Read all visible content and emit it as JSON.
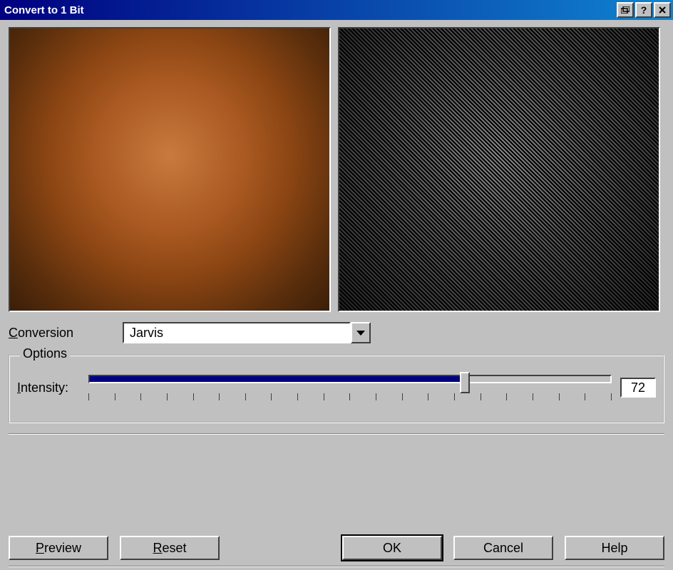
{
  "window": {
    "title": "Convert to 1 Bit"
  },
  "conversion": {
    "label_pre": "C",
    "label_rest": "onversion",
    "value": "Jarvis"
  },
  "options": {
    "group_title": "Options",
    "intensity": {
      "label_pre": "I",
      "label_rest": "ntensity:",
      "value": "72",
      "percent": 72
    }
  },
  "buttons": {
    "preview_pre": "P",
    "preview_rest": "review",
    "reset_pre": "R",
    "reset_rest": "eset",
    "ok": "OK",
    "cancel": "Cancel",
    "help": "Help"
  }
}
